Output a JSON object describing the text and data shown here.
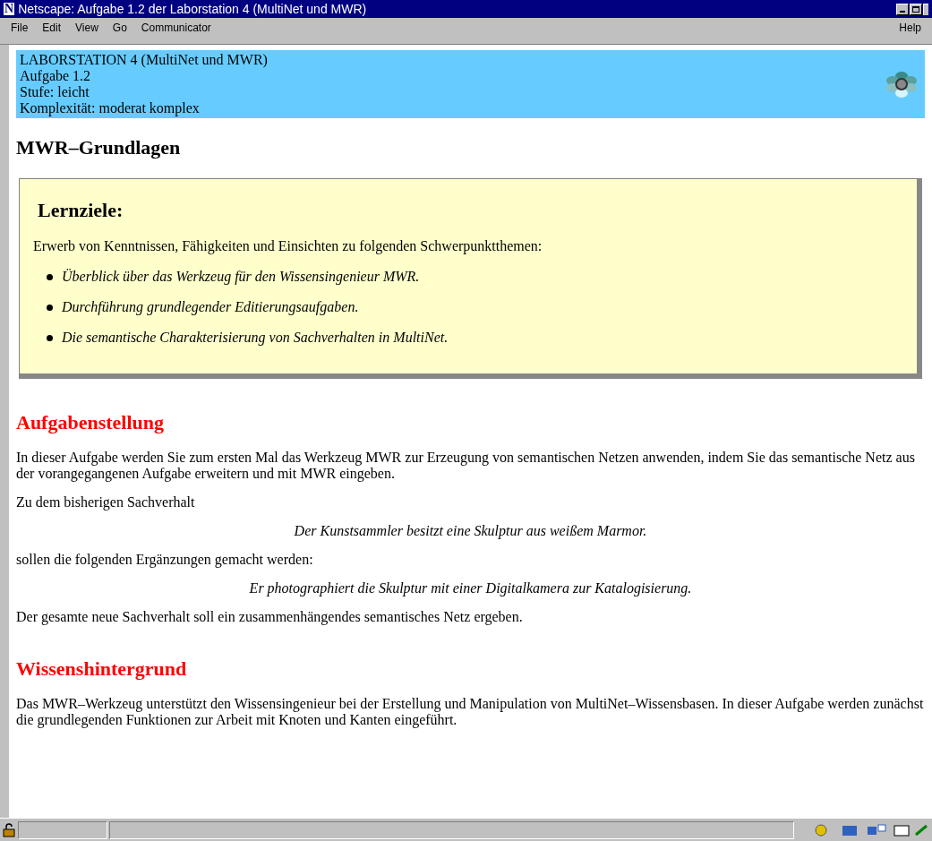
{
  "window": {
    "title": "Netscape: Aufgabe 1.2 der Laborstation 4 (MultiNet und MWR)",
    "app_letter": "N"
  },
  "menu": [
    "File",
    "Edit",
    "View",
    "Go",
    "Communicator"
  ],
  "help": "Help",
  "header": [
    "LABORSTATION 4 (MultiNet und MWR)",
    "Aufgabe 1.2",
    "Stufe: leicht",
    "Komplexität: moderat komplex"
  ],
  "title": "MWR–Grundlagen",
  "lernziele": {
    "title": "Lernziele:",
    "intro": "Erwerb von Kenntnissen, Fähigkeiten und Einsichten zu folgenden Schwerpunktthemen:",
    "items": [
      "Überblick über das Werkzeug für den Wissensingenieur MWR.",
      "Durchführung grundlegender Editierungsaufgaben.",
      "Die semantische Charakterisierung von Sachverhalten in MultiNet."
    ]
  },
  "sections": [
    {
      "heading": "Aufgabenstellung",
      "paragraphs": [
        {
          "kind": "text",
          "text": "In dieser Aufgabe werden Sie zum ersten Mal das Werkzeug MWR zur Erzeugung von semantischen Netzen anwenden, indem Sie das semantische Netz aus der vorangegangenen Aufgabe erweitern und mit MWR eingeben."
        },
        {
          "kind": "text",
          "text": "Zu dem bisherigen Sachverhalt"
        },
        {
          "kind": "quote",
          "text": "Der Kunstsammler besitzt eine Skulptur aus weißem Marmor."
        },
        {
          "kind": "text",
          "text": "sollen die folgenden Ergänzungen gemacht werden:"
        },
        {
          "kind": "quote",
          "text": "Er photographiert die Skulptur mit einer Digitalkamera zur Katalogisierung."
        },
        {
          "kind": "text",
          "text": "Der gesamte neue Sachverhalt soll ein zusammenhängendes semantisches Netz ergeben."
        }
      ]
    },
    {
      "heading": "Wissenshintergrund",
      "paragraphs": [
        {
          "kind": "text",
          "text": "Das MWR–Werkzeug unterstützt den Wissensingenieur bei der Erstellung und Manipulation von MultiNet–Wissensbasen. In dieser Aufgabe werden zunächst die grundlegenden Funktionen zur Arbeit mit Knoten und Kanten eingeführt."
        }
      ]
    }
  ]
}
